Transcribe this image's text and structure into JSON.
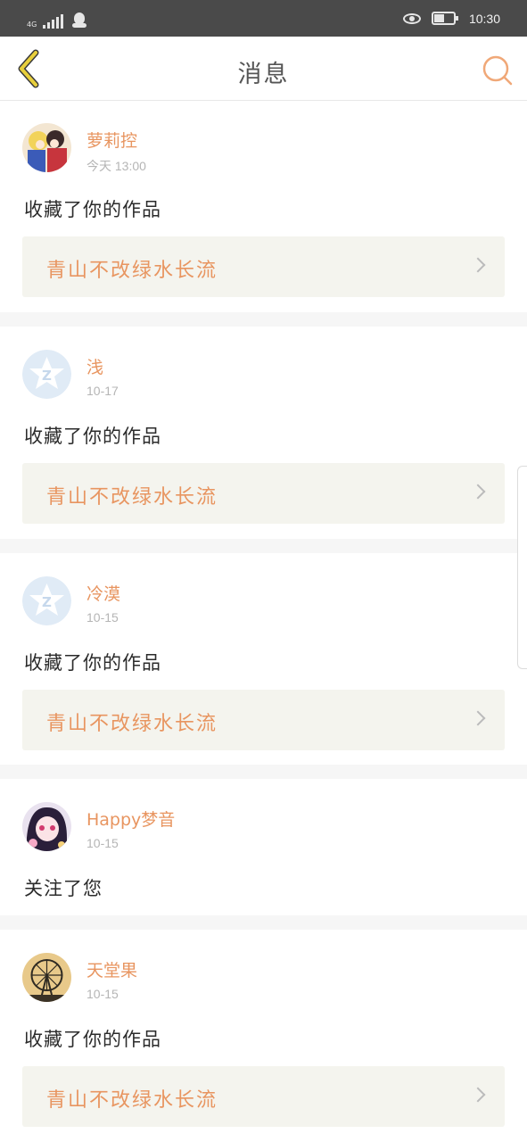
{
  "status_bar": {
    "network_label": "4G",
    "time": "10:30",
    "icons": [
      "signal-icon",
      "qq-icon",
      "eye-icon",
      "battery-icon"
    ]
  },
  "header": {
    "title": "消息",
    "back_icon": "back-chevron-icon",
    "search_icon": "search-icon"
  },
  "colors": {
    "accent": "#e89560",
    "back_icon": "#e0c32f",
    "card_link_bg": "#f4f4ee",
    "separator": "#f6f6f6",
    "status_bar": "#4a4a4a"
  },
  "notifications": [
    {
      "user": "萝莉控",
      "time": "今天 13:00",
      "action": "收藏了你的作品",
      "work_title": "青山不改绿水长流",
      "avatar": "anime-avatar"
    },
    {
      "user": "浅",
      "time": "10-17",
      "action": "收藏了你的作品",
      "work_title": "青山不改绿水长流",
      "avatar": "default-z-avatar"
    },
    {
      "user": "冷漠",
      "time": "10-15",
      "action": "收藏了你的作品",
      "work_title": "青山不改绿水长流",
      "avatar": "default-z-avatar"
    },
    {
      "user": "Happy梦音",
      "time": "10-15",
      "action": "关注了您",
      "avatar": "anime-girl-avatar"
    },
    {
      "user": "天堂果",
      "time": "10-15",
      "action": "收藏了你的作品",
      "work_title": "青山不改绿水长流",
      "avatar": "ferris-wheel-avatar"
    }
  ]
}
